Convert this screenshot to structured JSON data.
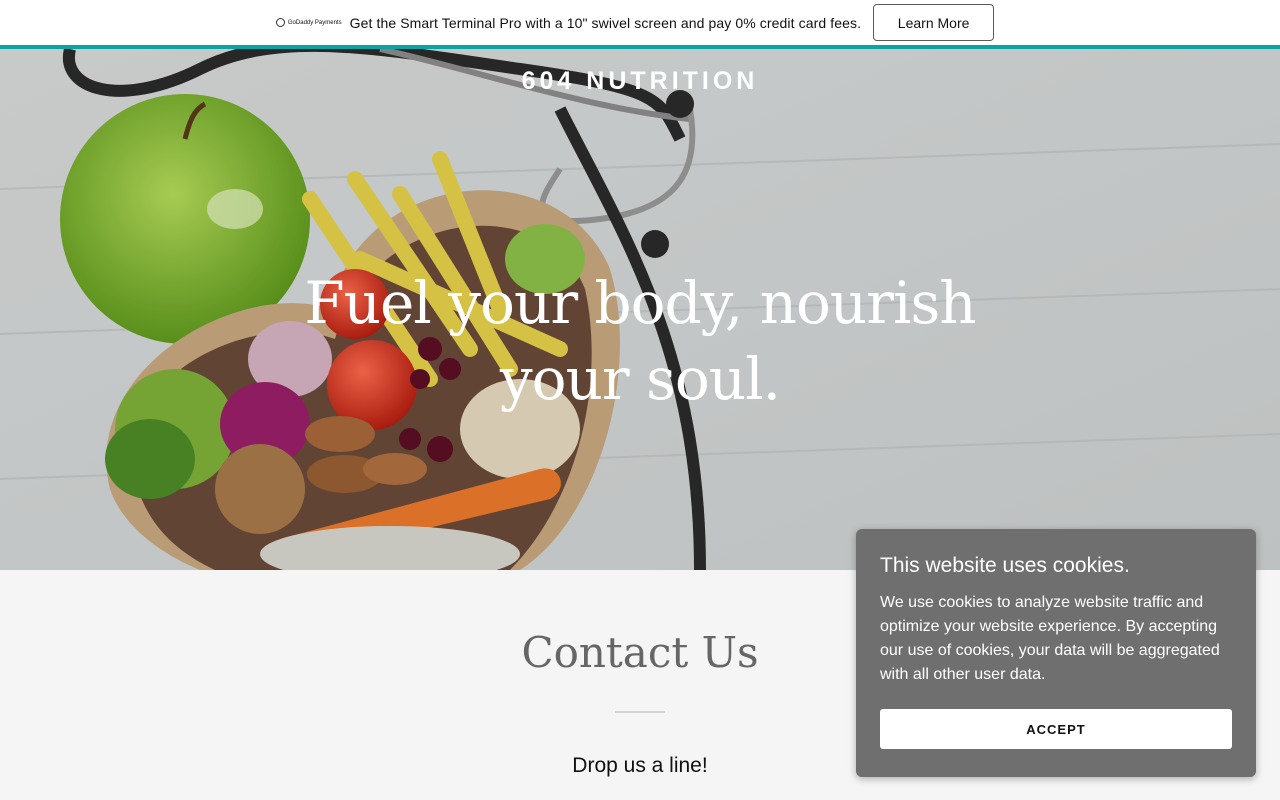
{
  "promo": {
    "logo_text": "GoDaddy Payments",
    "message": "Get the Smart Terminal Pro with a 10\" swivel screen and pay 0% credit card fees.",
    "button_label": "Learn More",
    "accent_color": "#09a3a4"
  },
  "hero": {
    "brand": "604 NUTRITION",
    "headline": "Fuel your body, nourish your soul.",
    "image_subject": "heart-shaped bowl of vegetables, fruit and nuts with stethoscope and green apple"
  },
  "contact": {
    "title": "Contact Us",
    "subtitle": "Drop us a line!"
  },
  "cookie": {
    "title": "This website uses cookies.",
    "body": "We use cookies to analyze website traffic and optimize your website experience. By accepting our use of cookies, your data will be aggregated with all other user data.",
    "button_label": "ACCEPT"
  }
}
